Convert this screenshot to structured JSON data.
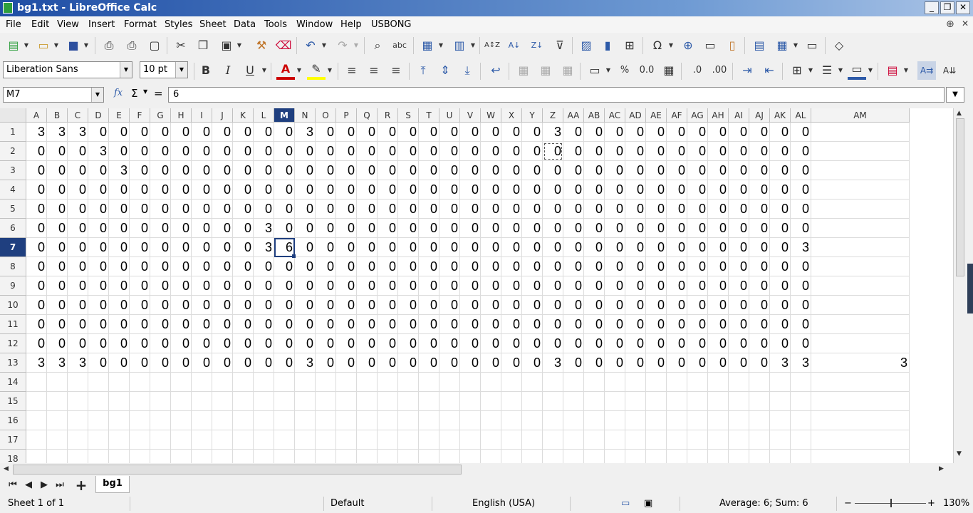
{
  "window": {
    "title": "bg1.txt - LibreOffice Calc",
    "controls": [
      "_",
      "❐",
      "✕"
    ]
  },
  "menu": {
    "items": [
      "File",
      "Edit",
      "View",
      "Insert",
      "Format",
      "Styles",
      "Sheet",
      "Data",
      "Tools",
      "Window",
      "Help",
      "USBONG"
    ],
    "globe_icon": "globe-icon",
    "close_glyph": "✕"
  },
  "toolbar": {
    "font_name": "Liberation Sans",
    "font_size": "10 pt",
    "bold": "B",
    "italic": "I",
    "underline": "U",
    "percent": "%",
    "number": "0.0",
    "add_decimal": ".0",
    "del_decimal": ".00"
  },
  "formula": {
    "name_box": "M7",
    "fx": "fx",
    "sum": "Σ",
    "equals": "=",
    "content": "6"
  },
  "grid": {
    "columns": [
      "A",
      "B",
      "C",
      "D",
      "E",
      "F",
      "G",
      "H",
      "I",
      "J",
      "K",
      "L",
      "M",
      "N",
      "O",
      "P",
      "Q",
      "R",
      "S",
      "T",
      "U",
      "V",
      "W",
      "X",
      "Y",
      "Z",
      "AA",
      "AB",
      "AC",
      "AD",
      "AE",
      "AF",
      "AG",
      "AH",
      "AI",
      "AJ",
      "AK",
      "AL",
      "AM"
    ],
    "row_numbers": [
      1,
      2,
      3,
      4,
      5,
      6,
      7,
      8,
      9,
      10,
      11,
      12,
      13,
      14,
      15,
      16,
      17,
      18
    ],
    "active_cell": "M7",
    "marked_cell": "Z2",
    "rows": [
      [
        3,
        3,
        3,
        0,
        0,
        0,
        0,
        0,
        0,
        0,
        0,
        0,
        0,
        3,
        0,
        0,
        0,
        0,
        0,
        0,
        0,
        0,
        0,
        0,
        0,
        3,
        0,
        0,
        0,
        0,
        0,
        0,
        0,
        0,
        0,
        0,
        0,
        0
      ],
      [
        0,
        0,
        0,
        3,
        0,
        0,
        0,
        0,
        0,
        0,
        0,
        0,
        0,
        0,
        0,
        0,
        0,
        0,
        0,
        0,
        0,
        0,
        0,
        0,
        0,
        0,
        0,
        0,
        0,
        0,
        0,
        0,
        0,
        0,
        0,
        0,
        0,
        0
      ],
      [
        0,
        0,
        0,
        0,
        3,
        0,
        0,
        0,
        0,
        0,
        0,
        0,
        0,
        0,
        0,
        0,
        0,
        0,
        0,
        0,
        0,
        0,
        0,
        0,
        0,
        0,
        0,
        0,
        0,
        0,
        0,
        0,
        0,
        0,
        0,
        0,
        0,
        0
      ],
      [
        0,
        0,
        0,
        0,
        0,
        0,
        0,
        0,
        0,
        0,
        0,
        0,
        0,
        0,
        0,
        0,
        0,
        0,
        0,
        0,
        0,
        0,
        0,
        0,
        0,
        0,
        0,
        0,
        0,
        0,
        0,
        0,
        0,
        0,
        0,
        0,
        0,
        0
      ],
      [
        0,
        0,
        0,
        0,
        0,
        0,
        0,
        0,
        0,
        0,
        0,
        0,
        0,
        0,
        0,
        0,
        0,
        0,
        0,
        0,
        0,
        0,
        0,
        0,
        0,
        0,
        0,
        0,
        0,
        0,
        0,
        0,
        0,
        0,
        0,
        0,
        0,
        0
      ],
      [
        0,
        0,
        0,
        0,
        0,
        0,
        0,
        0,
        0,
        0,
        0,
        3,
        0,
        0,
        0,
        0,
        0,
        0,
        0,
        0,
        0,
        0,
        0,
        0,
        0,
        0,
        0,
        0,
        0,
        0,
        0,
        0,
        0,
        0,
        0,
        0,
        0,
        0
      ],
      [
        0,
        0,
        0,
        0,
        0,
        0,
        0,
        0,
        0,
        0,
        0,
        3,
        6,
        0,
        0,
        0,
        0,
        0,
        0,
        0,
        0,
        0,
        0,
        0,
        0,
        0,
        0,
        0,
        0,
        0,
        0,
        0,
        0,
        0,
        0,
        0,
        0,
        3
      ],
      [
        0,
        0,
        0,
        0,
        0,
        0,
        0,
        0,
        0,
        0,
        0,
        0,
        0,
        0,
        0,
        0,
        0,
        0,
        0,
        0,
        0,
        0,
        0,
        0,
        0,
        0,
        0,
        0,
        0,
        0,
        0,
        0,
        0,
        0,
        0,
        0,
        0,
        0
      ],
      [
        0,
        0,
        0,
        0,
        0,
        0,
        0,
        0,
        0,
        0,
        0,
        0,
        0,
        0,
        0,
        0,
        0,
        0,
        0,
        0,
        0,
        0,
        0,
        0,
        0,
        0,
        0,
        0,
        0,
        0,
        0,
        0,
        0,
        0,
        0,
        0,
        0,
        0
      ],
      [
        0,
        0,
        0,
        0,
        0,
        0,
        0,
        0,
        0,
        0,
        0,
        0,
        0,
        0,
        0,
        0,
        0,
        0,
        0,
        0,
        0,
        0,
        0,
        0,
        0,
        0,
        0,
        0,
        0,
        0,
        0,
        0,
        0,
        0,
        0,
        0,
        0,
        0
      ],
      [
        0,
        0,
        0,
        0,
        0,
        0,
        0,
        0,
        0,
        0,
        0,
        0,
        0,
        0,
        0,
        0,
        0,
        0,
        0,
        0,
        0,
        0,
        0,
        0,
        0,
        0,
        0,
        0,
        0,
        0,
        0,
        0,
        0,
        0,
        0,
        0,
        0,
        0
      ],
      [
        0,
        0,
        0,
        0,
        0,
        0,
        0,
        0,
        0,
        0,
        0,
        0,
        0,
        0,
        0,
        0,
        0,
        0,
        0,
        0,
        0,
        0,
        0,
        0,
        0,
        0,
        0,
        0,
        0,
        0,
        0,
        0,
        0,
        0,
        0,
        0,
        0,
        0
      ],
      [
        3,
        3,
        3,
        0,
        0,
        0,
        0,
        0,
        0,
        0,
        0,
        0,
        0,
        3,
        0,
        0,
        0,
        0,
        0,
        0,
        0,
        0,
        0,
        0,
        0,
        3,
        0,
        0,
        0,
        0,
        0,
        0,
        0,
        0,
        0,
        0,
        3,
        3,
        3
      ]
    ]
  },
  "sheet_tabs": {
    "tabs": [
      "bg1"
    ],
    "add": "+"
  },
  "status": {
    "sheet": "Sheet 1 of 1",
    "style": "Default",
    "language": "English (USA)",
    "summary": "Average: 6; Sum: 6",
    "zoom": "130%",
    "zoom_minus": "−",
    "zoom_plus": "+"
  },
  "colors": {
    "selection": "#1f3f7f",
    "titlebar": "#1f4ea5"
  }
}
